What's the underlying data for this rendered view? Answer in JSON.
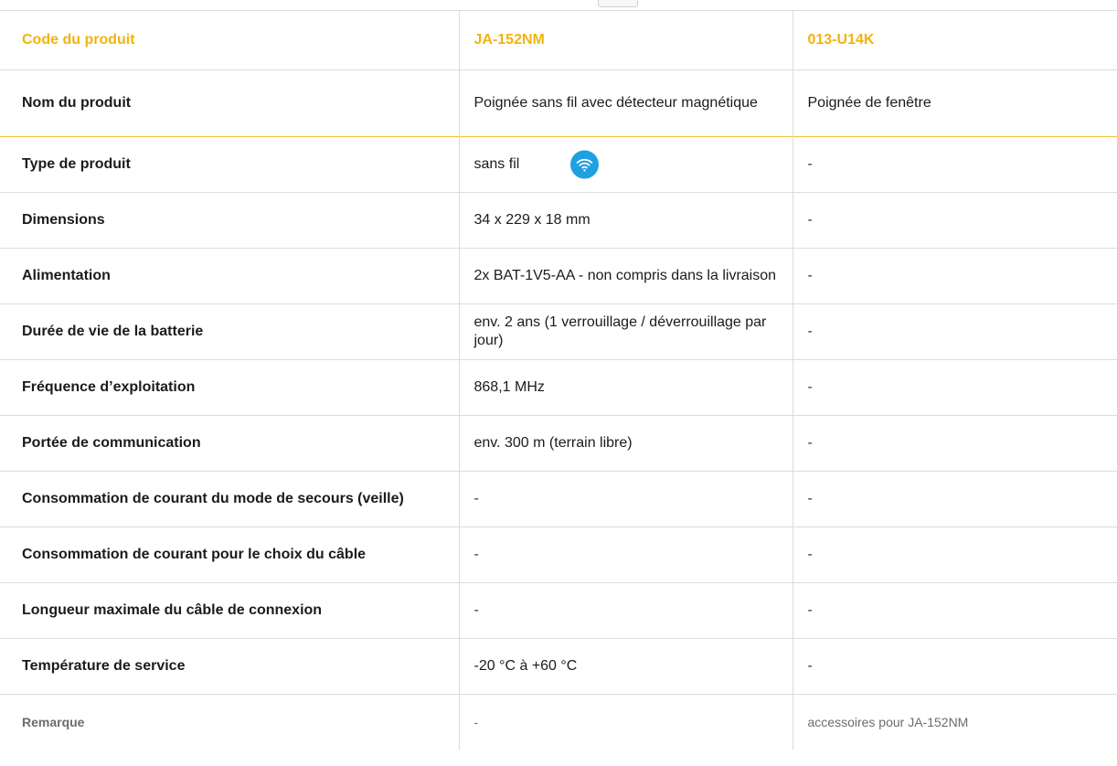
{
  "table": {
    "header": {
      "label": "Code du produit",
      "col2": "JA-152NM",
      "col3": "013-U14K"
    },
    "rows": [
      {
        "label": "Nom du produit",
        "col2": "Poignée sans fil avec détecteur magnétique",
        "col3": "Poignée de fenêtre"
      },
      {
        "label": "Type de produit",
        "col2": "sans fil",
        "col2_icon": "wifi-icon",
        "col3": "-"
      },
      {
        "label": "Dimensions",
        "col2": "34 x 229 x 18 mm",
        "col3": "-"
      },
      {
        "label": "Alimentation",
        "col2": "2x BAT-1V5-AA - non compris dans la livraison",
        "col3": "-"
      },
      {
        "label": "Durée de vie de la batterie",
        "col2": "env. 2 ans (1 verrouillage / déverrouillage par jour)",
        "col3": "-"
      },
      {
        "label": "Fréquence d’exploitation",
        "col2": "868,1 MHz",
        "col3": "-"
      },
      {
        "label": "Portée de communication",
        "col2": "env. 300 m (terrain libre)",
        "col3": "-"
      },
      {
        "label": "Consommation de courant du mode de secours (veille)",
        "col2": "-",
        "col3": "-"
      },
      {
        "label": "Consommation de courant pour le choix du câble",
        "col2": "-",
        "col3": "-"
      },
      {
        "label": "Longueur maximale du câble de connexion",
        "col2": "-",
        "col3": "-"
      },
      {
        "label": "Température de service",
        "col2": "-20 °C à +60 °C",
        "col3": "-"
      },
      {
        "label": "Remarque",
        "col2": "-",
        "col3": "accessoires pour JA-152NM"
      }
    ]
  },
  "colors": {
    "accent": "#f2b30f",
    "wifi_badge": "#1fa0e0",
    "border": "#dcdcdc"
  }
}
